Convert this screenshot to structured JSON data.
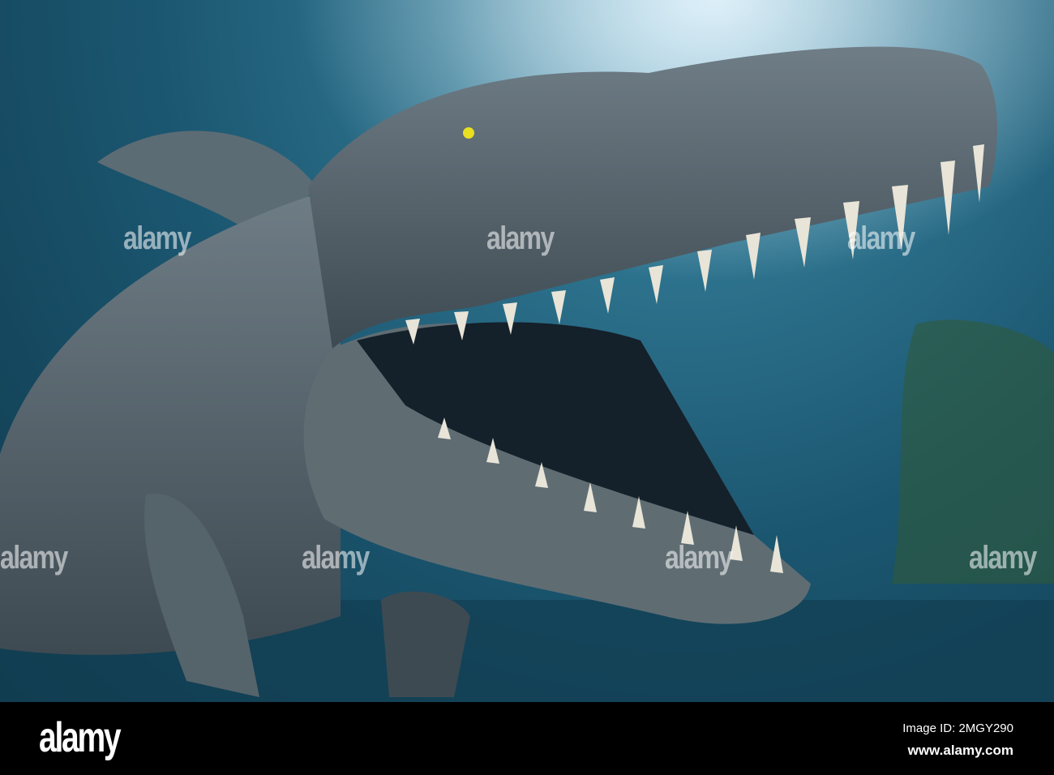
{
  "photo": {
    "subject": "underwater marine reptile with open jaws",
    "watermark_text": "alamy",
    "colors": {
      "water": "#1b5670",
      "highlight": "#9fd0e0",
      "skin": "#5b6a72",
      "teeth": "#e8e4d8",
      "eye": "#e8e020"
    }
  },
  "footer": {
    "logo": "alamy",
    "image_id": "Image ID: 2MGY290",
    "website": "www.alamy.com"
  }
}
